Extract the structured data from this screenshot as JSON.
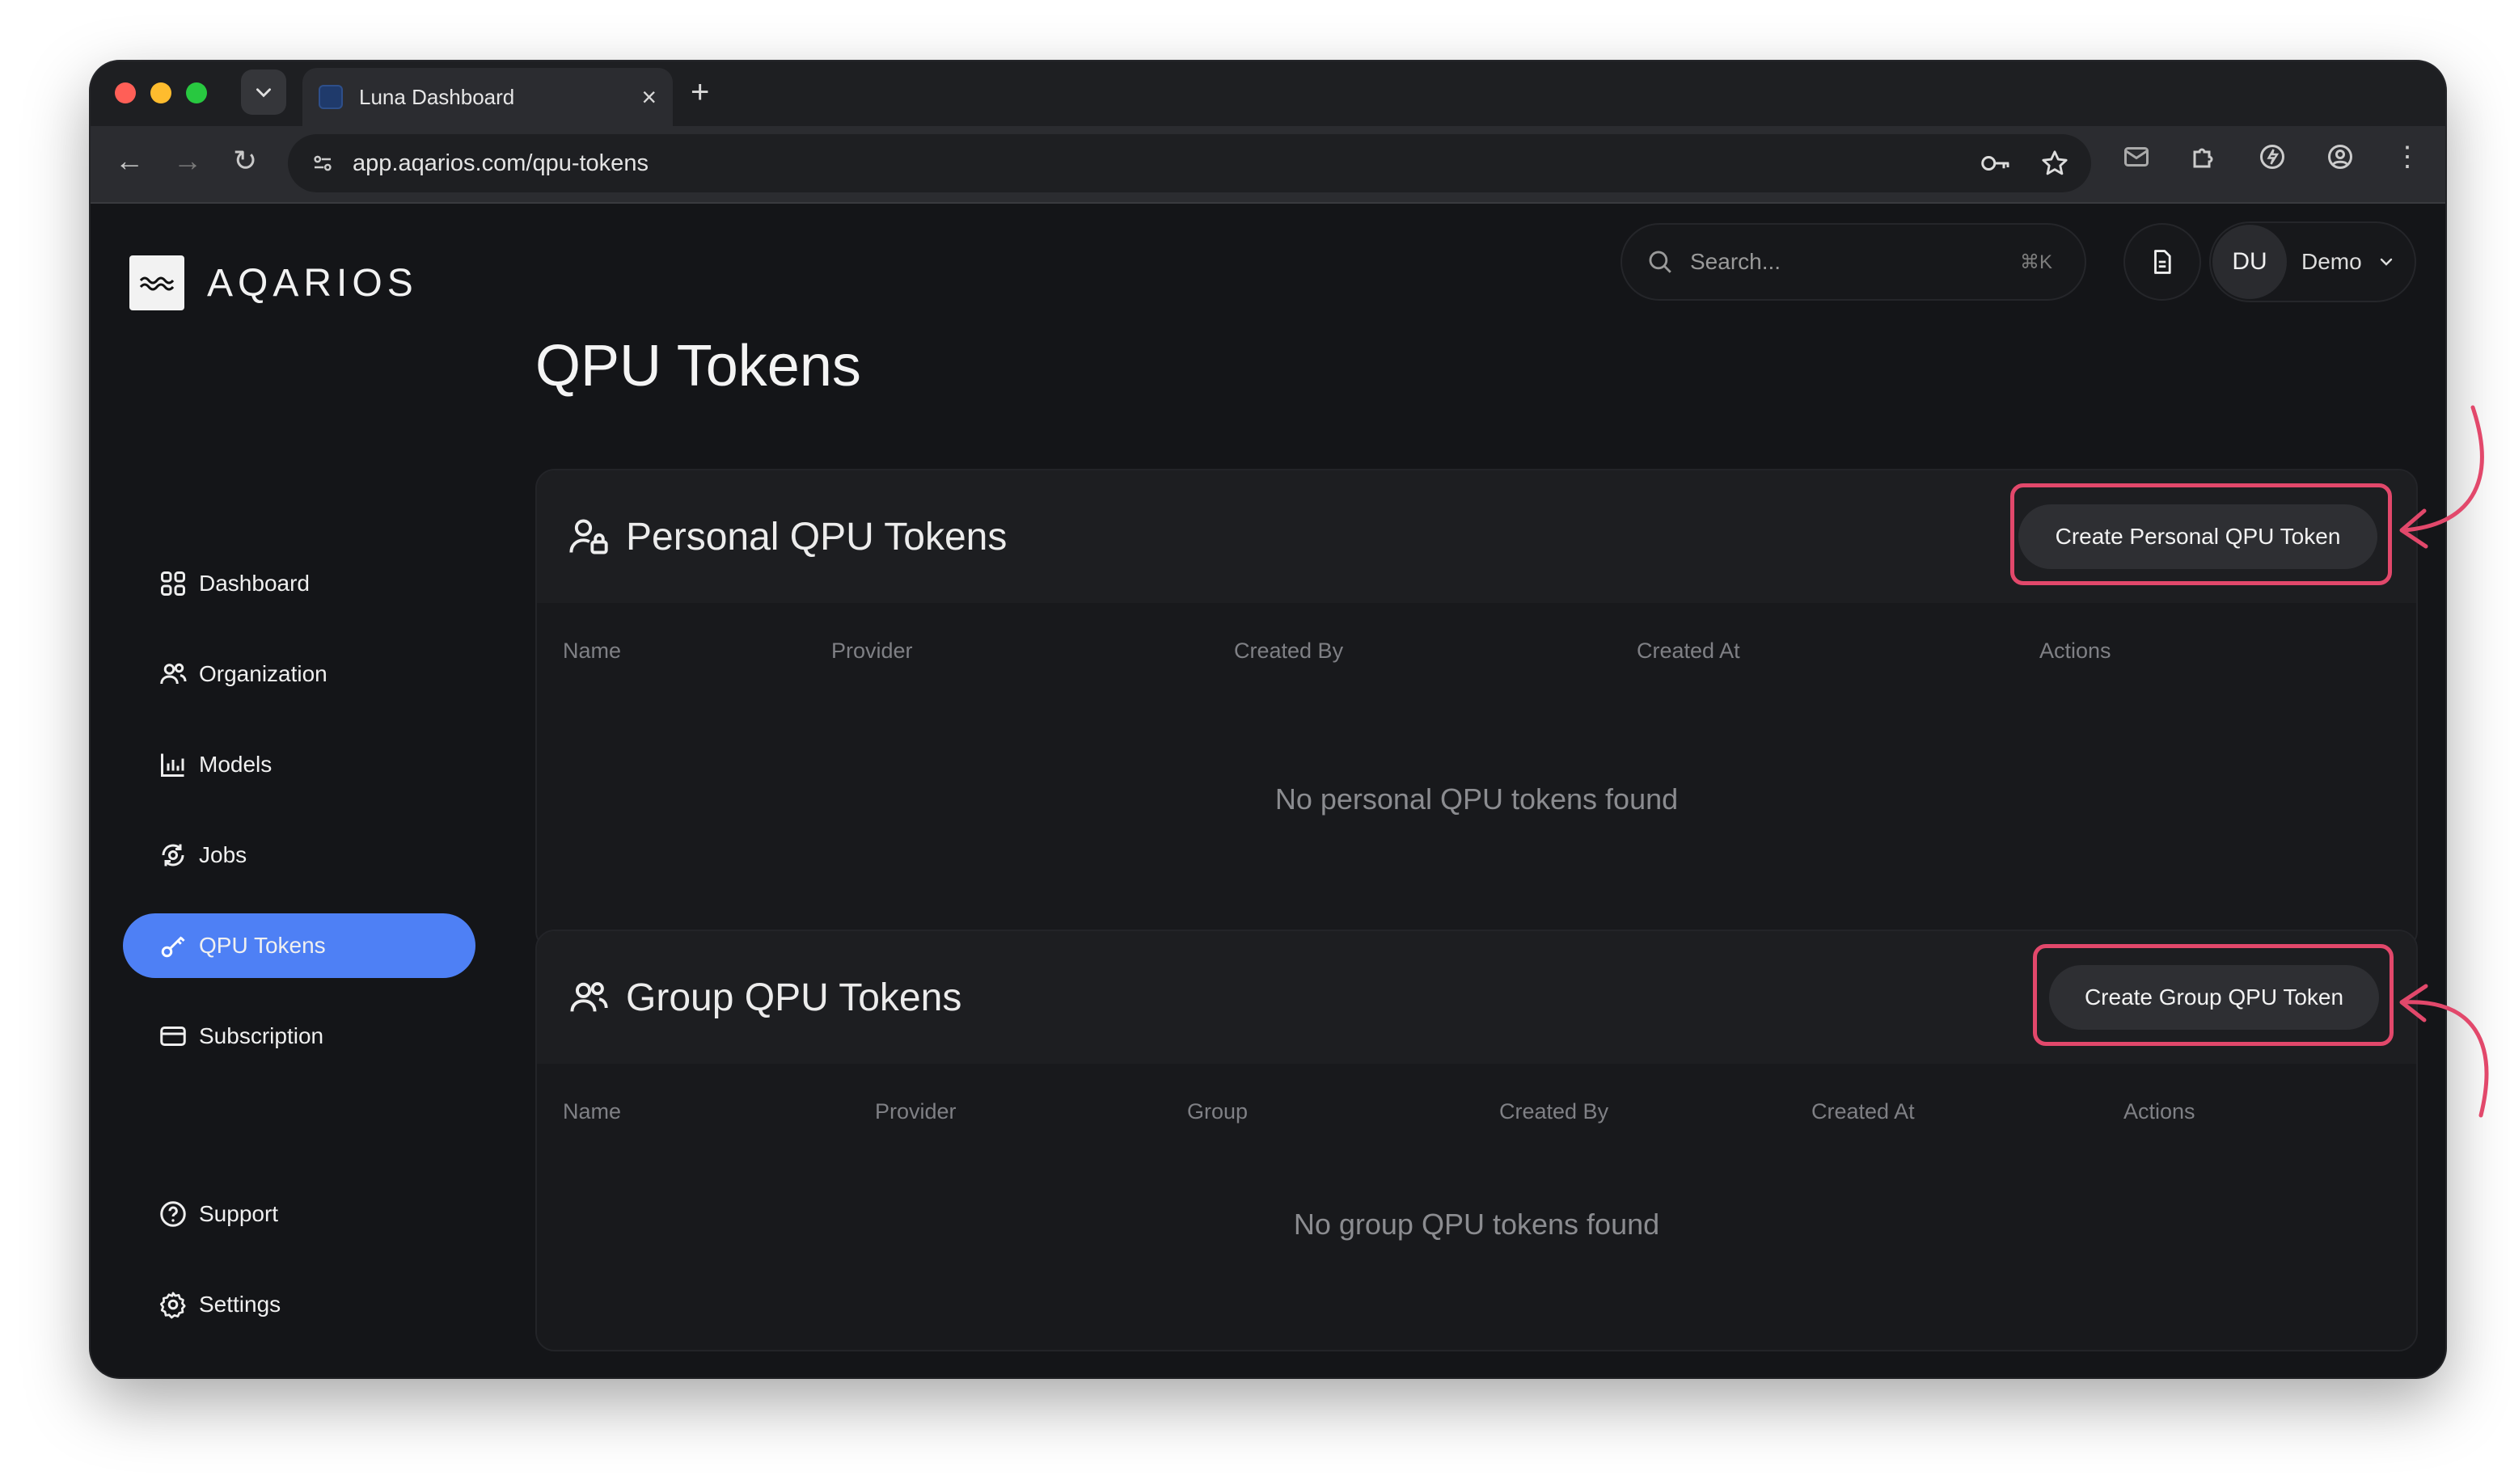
{
  "browser": {
    "tab_title": "Luna Dashboard",
    "url": "app.aqarios.com/qpu-tokens"
  },
  "brand": {
    "name": "AQARIOS"
  },
  "sidebar": {
    "items": [
      {
        "label": "Dashboard",
        "icon": "grid-icon"
      },
      {
        "label": "Organization",
        "icon": "users-icon"
      },
      {
        "label": "Models",
        "icon": "chart-icon"
      },
      {
        "label": "Jobs",
        "icon": "cycle-icon"
      },
      {
        "label": "QPU Tokens",
        "icon": "key-icon",
        "active": true
      },
      {
        "label": "Subscription",
        "icon": "card-icon"
      }
    ],
    "bottom_items": [
      {
        "label": "Support",
        "icon": "help-icon"
      },
      {
        "label": "Settings",
        "icon": "gear-icon"
      }
    ]
  },
  "header": {
    "search_placeholder": "Search...",
    "search_shortcut": "⌘K",
    "avatar_initials": "DU",
    "user_name": "Demo"
  },
  "page": {
    "title": "QPU Tokens"
  },
  "personal": {
    "title": "Personal QPU Tokens",
    "create_label": "Create Personal QPU Token",
    "columns": [
      "Name",
      "Provider",
      "Created By",
      "Created At",
      "Actions"
    ],
    "empty": "No personal QPU tokens found"
  },
  "group": {
    "title": "Group QPU Tokens",
    "create_label": "Create Group QPU Token",
    "columns": [
      "Name",
      "Provider",
      "Group",
      "Created By",
      "Created At",
      "Actions"
    ],
    "empty": "No group QPU tokens found"
  },
  "colors": {
    "accent": "#4e80f5",
    "highlight": "#e2486b"
  }
}
